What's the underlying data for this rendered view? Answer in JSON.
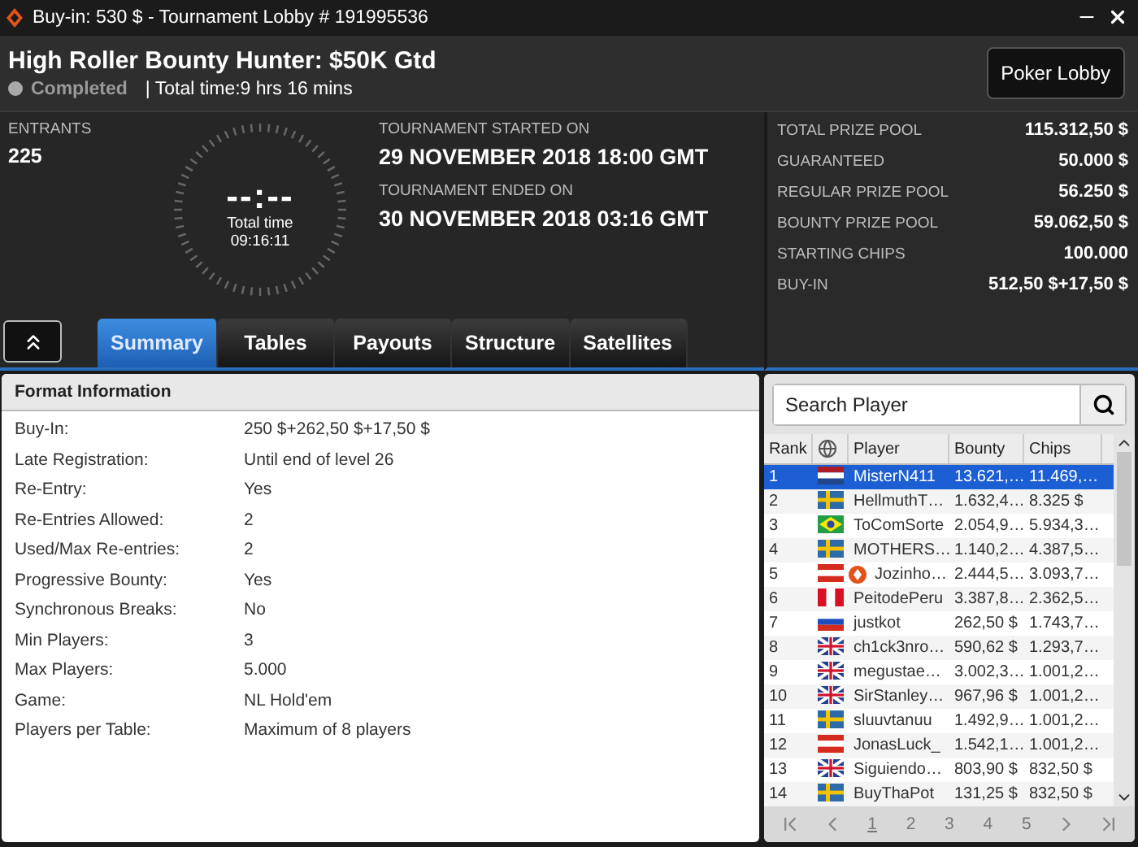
{
  "window": {
    "title": "Buy-in: 530 $ - Tournament Lobby # 191995536"
  },
  "header": {
    "title": "High Roller Bounty Hunter: $50K Gtd",
    "status": {
      "label": "Completed",
      "kind": "completed"
    },
    "total_time": "| Total time:9 hrs  16 mins",
    "lobby_button": "Poker Lobby"
  },
  "entrants": {
    "label": "ENTRANTS",
    "value": "225"
  },
  "clock": {
    "display": "--:--",
    "label": "Total time",
    "value": "09:16:11"
  },
  "dates": [
    {
      "label": "TOURNAMENT STARTED ON",
      "value": "29 NOVEMBER 2018  18:00 GMT"
    },
    {
      "label": "TOURNAMENT ENDED ON",
      "value": "30 NOVEMBER 2018  03:16 GMT"
    }
  ],
  "prize_info": [
    {
      "label": "TOTAL PRIZE POOL",
      "value": "115.312,50 $"
    },
    {
      "label": "GUARANTEED",
      "value": "50.000 $"
    },
    {
      "label": "REGULAR PRIZE POOL",
      "value": "56.250 $"
    },
    {
      "label": "BOUNTY PRIZE POOL",
      "value": "59.062,50 $"
    },
    {
      "label": "STARTING CHIPS",
      "value": "100.000"
    },
    {
      "label": "BUY-IN",
      "value": "512,50 $+17,50 $"
    }
  ],
  "tabs": [
    {
      "label": "Summary",
      "selected": true
    },
    {
      "label": "Tables",
      "selected": false
    },
    {
      "label": "Payouts",
      "selected": false
    },
    {
      "label": "Structure",
      "selected": false
    },
    {
      "label": "Satellites",
      "selected": false
    }
  ],
  "format_info": {
    "title": "Format Information",
    "rows": [
      {
        "label": "Buy-In:",
        "value": "250 $+262,50 $+17,50 $"
      },
      {
        "label": "Late Registration:",
        "value": "Until end of level 26"
      },
      {
        "label": "Re-Entry:",
        "value": "Yes"
      },
      {
        "label": "Re-Entries Allowed:",
        "value": "2"
      },
      {
        "label": "Used/Max Re-entries:",
        "value": "2"
      },
      {
        "label": "Progressive Bounty:",
        "value": "Yes"
      },
      {
        "label": "Synchronous Breaks:",
        "value": "No"
      },
      {
        "label": "Min Players:",
        "value": "3"
      },
      {
        "label": "Max Players:",
        "value": "5.000"
      },
      {
        "label": "Game:",
        "value": "NL Hold'em"
      },
      {
        "label": "Players per Table:",
        "value": "Maximum of 8 players"
      }
    ]
  },
  "players": {
    "search": {
      "placeholder": "Search Player"
    },
    "columns": [
      "Rank",
      "Player",
      "Bounty",
      "Chips"
    ],
    "rows": [
      {
        "rank": "1",
        "kind": "nl",
        "badge": false,
        "player": "MisterN411",
        "bounty": "13.621,…",
        "chips": "11.469,…",
        "selected": true
      },
      {
        "rank": "2",
        "kind": "se",
        "badge": false,
        "player": "HellmuthT…",
        "bounty": "1.632,4…",
        "chips": "8.325 $",
        "selected": false
      },
      {
        "rank": "3",
        "kind": "br",
        "badge": false,
        "player": "ToComSorte",
        "bounty": "2.054,9…",
        "chips": "5.934,3…",
        "selected": false
      },
      {
        "rank": "4",
        "kind": "se",
        "badge": false,
        "player": "MOTHERS…",
        "bounty": "1.140,2…",
        "chips": "4.387,5…",
        "selected": false
      },
      {
        "rank": "5",
        "kind": "at",
        "badge": true,
        "player": "Jozinho…",
        "bounty": "2.444,5…",
        "chips": "3.093,7…",
        "selected": false
      },
      {
        "rank": "6",
        "kind": "pe",
        "badge": false,
        "player": "PeitodePeru",
        "bounty": "3.387,8…",
        "chips": "2.362,5…",
        "selected": false
      },
      {
        "rank": "7",
        "kind": "ru",
        "badge": false,
        "player": "justkot",
        "bounty": "262,50 $",
        "chips": "1.743,7…",
        "selected": false
      },
      {
        "rank": "8",
        "kind": "gb",
        "badge": false,
        "player": "ch1ck3nro…",
        "bounty": "590,62 $",
        "chips": "1.293,7…",
        "selected": false
      },
      {
        "rank": "9",
        "kind": "gb",
        "badge": false,
        "player": "megustae…",
        "bounty": "3.002,3…",
        "chips": "1.001,2…",
        "selected": false
      },
      {
        "rank": "10",
        "kind": "gb",
        "badge": false,
        "player": "SirStanley…",
        "bounty": "967,96 $",
        "chips": "1.001,2…",
        "selected": false
      },
      {
        "rank": "11",
        "kind": "se",
        "badge": false,
        "player": "sluuvtanuu",
        "bounty": "1.492,9…",
        "chips": "1.001,2…",
        "selected": false
      },
      {
        "rank": "12",
        "kind": "at",
        "badge": false,
        "player": "JonasLuck_",
        "bounty": "1.542,1…",
        "chips": "1.001,2…",
        "selected": false
      },
      {
        "rank": "13",
        "kind": "gb",
        "badge": false,
        "player": "Siguiendo…",
        "bounty": "803,90 $",
        "chips": "832,50 $",
        "selected": false
      },
      {
        "rank": "14",
        "kind": "se",
        "badge": false,
        "player": "BuyThaPot",
        "bounty": "131,25 $",
        "chips": "832,50 $",
        "selected": false
      }
    ],
    "pages": [
      {
        "label": "1",
        "selected": true
      },
      {
        "label": "2",
        "selected": false
      },
      {
        "label": "3",
        "selected": false
      },
      {
        "label": "4",
        "selected": false
      },
      {
        "label": "5",
        "selected": false
      }
    ]
  }
}
